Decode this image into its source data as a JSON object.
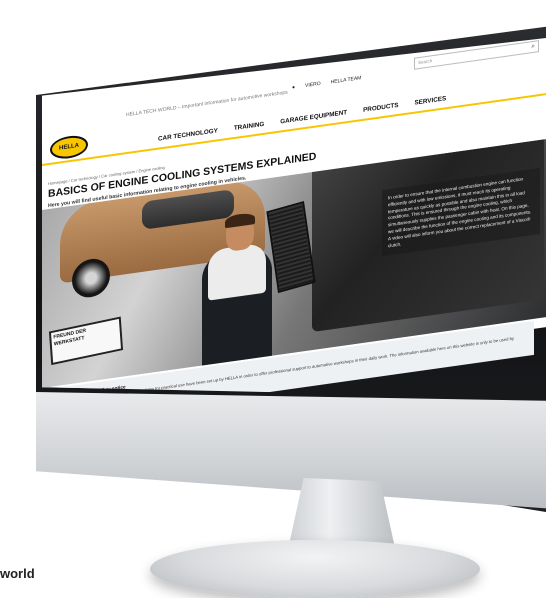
{
  "header": {
    "tagline": "HELLA TECH WORLD – Important information for automotive workshops",
    "utility": [
      "VIERO",
      "HELLA TEAM"
    ],
    "search_placeholder": "Search"
  },
  "nav": {
    "items": [
      "CAR TECHNOLOGY",
      "TRAINING",
      "GARAGE EQUIPMENT",
      "PRODUCTS",
      "SERVICES"
    ]
  },
  "main": {
    "breadcrumb": "Homepage / Car technology / Car cooling system / Engine cooling",
    "title": "BASICS OF ENGINE COOLING SYSTEMS EXPLAINED",
    "subtitle": "Here you will find useful basic information relating to engine cooling in vehicles.",
    "hero_text": "In order to ensure that the internal combustion engine can function efficiently and with low emissions, it must reach its operating temperature as quickly as possible and also maintain this in all load conditions. This is ensured through the engine cooling, which simultaneously supplies the passenger cabin with heat. On this page, we will describe the function of the engine cooling and its components. A video will also inform you about the correct replacement of a Visco® clutch.",
    "stamp_text": "FREUND DER WERKSTATT"
  },
  "notice": {
    "title": "Important safety notice",
    "body": "The following technical information and tips for practical use have been set up by HELLA in order to offer professional support to automotive workshops in their daily work. The information available here on this website is only to be used by appropriately trained specialist staff."
  },
  "footer_text": "world",
  "logo_text": "HELLA"
}
